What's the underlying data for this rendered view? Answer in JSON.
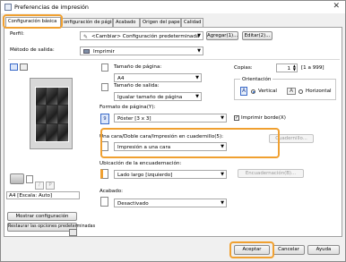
{
  "window": {
    "title": "Preferencias de impresión"
  },
  "tabs": [
    {
      "label": "Configuración básica"
    },
    {
      "label": "onfiguración de página"
    },
    {
      "label": "Acabado"
    },
    {
      "label": "Origen del papel"
    },
    {
      "label": "Calidad"
    }
  ],
  "profile": {
    "label": "Perfil:",
    "value": "<Cambiar> Configuración predeterminada",
    "add_button": "Agregar(1)...",
    "edit_button": "Editar(2)..."
  },
  "output_method": {
    "label": "Método de salida:",
    "value": "Imprimir"
  },
  "preview": {
    "caption": "A4 [Escala: Auto]"
  },
  "page_size": {
    "label": "Tamaño de página:",
    "value": "A4"
  },
  "output_size": {
    "label": "Tamaño de salida:",
    "value": "Igualar tamaño de página"
  },
  "copies": {
    "label": "Copias:",
    "value": "1",
    "range": "[1 a 999]"
  },
  "orientation": {
    "label": "Orientación",
    "portrait": "Vertical",
    "landscape": "Horizontal",
    "selected": "portrait"
  },
  "page_layout": {
    "label": "Formato de página(Y):",
    "value": "Póster [3 x 3]",
    "print_borders_label": "Imprimir borde(X)",
    "print_borders_checked": true
  },
  "duplex": {
    "label": "Una cara/Doble cara/Impresión en cuadernillo(5):",
    "value": "Impresión a una cara",
    "booklet_button": "Cuadernillo..."
  },
  "binding": {
    "label": "Ubicación de la encuadernación:",
    "value": "Lado largo [izquierdo]",
    "binding_button": "Encuadernación(B)..."
  },
  "finishing": {
    "label": "Acabado:",
    "value": "Desactivado"
  },
  "side_buttons": {
    "show_settings": "Mostrar configuración",
    "restore_defaults": "Restaurar las opciones predeterminadas"
  },
  "footer": {
    "ok": "Aceptar",
    "cancel": "Cancelar",
    "help": "Ayuda"
  }
}
